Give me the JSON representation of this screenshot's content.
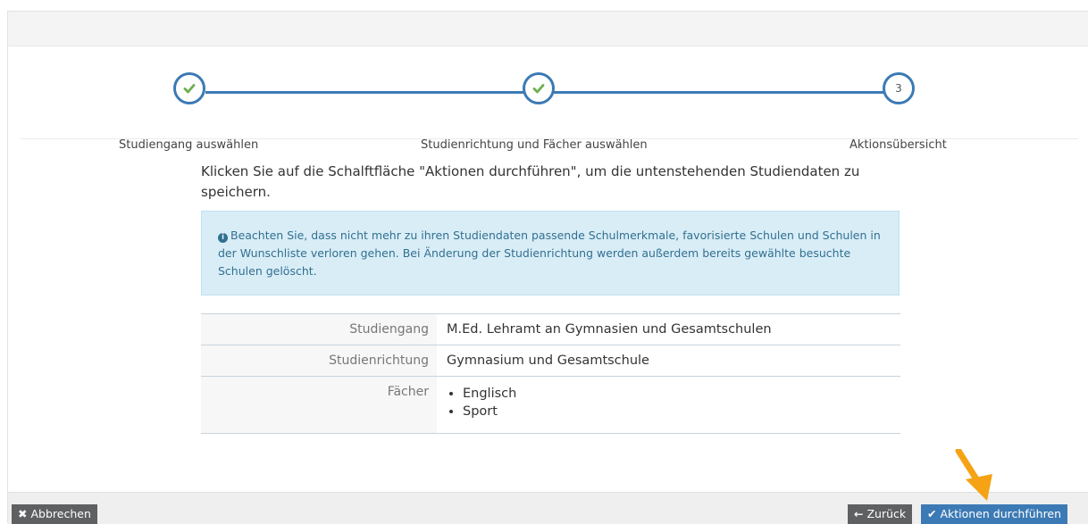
{
  "stepper": {
    "steps": [
      {
        "label": "Studiengang auswählen",
        "state": "done"
      },
      {
        "label": "Studienrichtung und Fächer auswählen",
        "state": "done"
      },
      {
        "label": "Aktionsübersicht",
        "state": "current",
        "number": "3"
      }
    ]
  },
  "intro_text": "Klicken Sie auf die Schalftfläche \"Aktionen durchführen\", um die untenstehenden Studiendaten zu speichern.",
  "alert": {
    "text": "Beachten Sie, dass nicht mehr zu ihren Studiendaten passende Schulmerkmale, favorisierte Schulen und Schulen in der Wunschliste verloren gehen. Bei Änderung der Studienrichtung werden außerdem bereits gewählte besuchte Schulen gelöscht.",
    "icon": "info-circle-icon"
  },
  "summary": {
    "rows": [
      {
        "key": "Studiengang",
        "value": "M.Ed. Lehramt an Gymnasien und Gesamtschulen"
      },
      {
        "key": "Studienrichtung",
        "value": "Gymnasium und Gesamtschule"
      },
      {
        "key": "Fächer",
        "items": [
          "Englisch",
          "Sport"
        ]
      }
    ]
  },
  "footer": {
    "cancel_label": "Abbrechen",
    "back_label": "Zurück",
    "execute_label": "Aktionen durchführen"
  },
  "colors": {
    "accent": "#3c7ab5",
    "check": "#6ab04c",
    "alert_bg": "#d9edf7",
    "alert_text": "#31708f",
    "button_dark": "#5f6061",
    "arrow": "#f5a214"
  }
}
